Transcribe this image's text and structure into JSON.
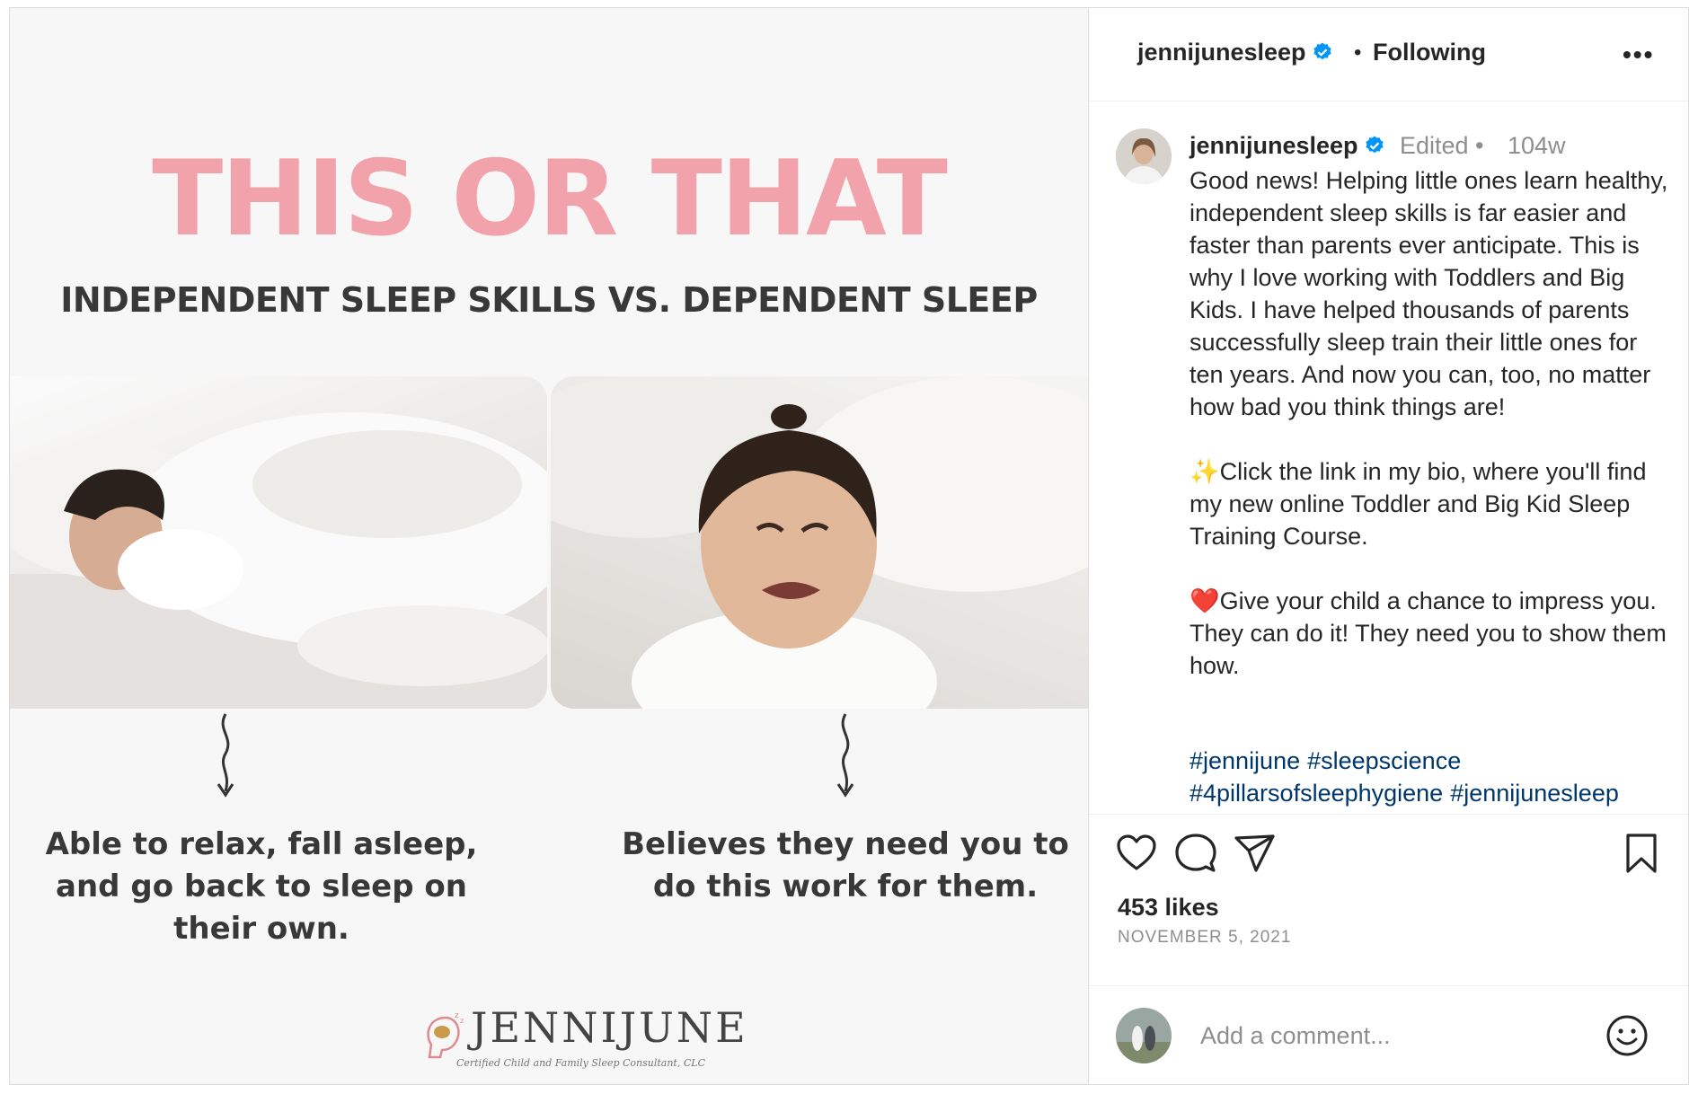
{
  "post_image": {
    "title": "THIS OR THAT",
    "subtitle": "INDEPENDENT SLEEP SKILLS VS. DEPENDENT SLEEP",
    "left_caption": "Able to relax, fall asleep, and go back to sleep on their own.",
    "right_caption": "Believes they need you to do this work for them.",
    "logo_word": "JENNIJUNE",
    "logo_tagline": "Certified Child and Family Sleep Consultant, CLC"
  },
  "header": {
    "username": "jennijunesleep",
    "separator": "•",
    "follow_status": "Following",
    "more_label": "•••"
  },
  "post": {
    "username": "jennijunesleep",
    "edited": "Edited •",
    "time": "104w",
    "caption": "Good news! Helping little ones learn healthy, independent sleep skills is far easier and faster than parents ever anticipate. This is why I love working with Toddlers and Big Kids. I have helped thousands of parents successfully sleep train their little ones for ten years. And now you can, too, no matter how bad you think things are!\n\n✨Click the link in my bio, where you'll find my new online Toddler and Big Kid Sleep Training Course.\n\n❤️Give your child a chance to impress you. They can do it! They need you to show them how.",
    "hashtags": [
      "#jennijune",
      "#sleepscience",
      "#4pillarsofsleephygiene",
      "#jennijunesleep"
    ]
  },
  "stats": {
    "likes": "453 likes",
    "date": "NOVEMBER 5, 2021"
  },
  "comment": {
    "placeholder": "Add a comment..."
  },
  "icons": {
    "verified": "verified-badge-icon",
    "like": "heart-icon",
    "comment": "comment-bubble-icon",
    "share": "paper-plane-icon",
    "save": "bookmark-icon",
    "emoji": "smiley-icon"
  },
  "colors": {
    "title_pink": "#f2a2aa",
    "verified_blue": "#0095f6",
    "hashtag_blue": "#00376b",
    "muted": "#8e8e8e"
  }
}
